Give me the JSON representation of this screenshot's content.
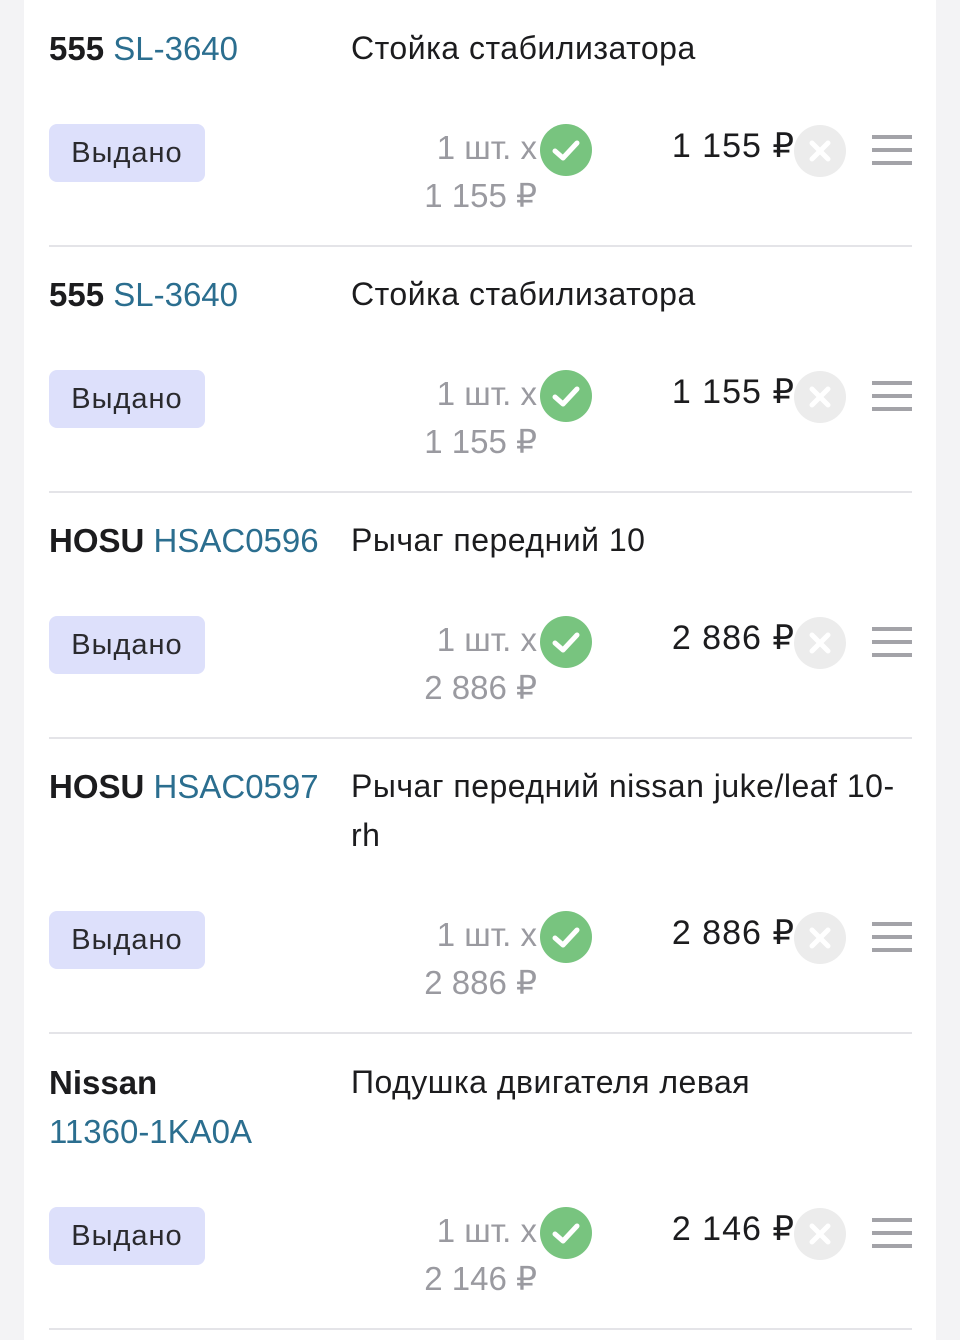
{
  "items": [
    {
      "brand": "555",
      "code": "SL-3640",
      "name": "Стойка стабилизатора",
      "status": "Выдано",
      "qty": "1 шт. x",
      "unit_price": "1 155 ₽",
      "total": "1 155 ₽"
    },
    {
      "brand": "555",
      "code": "SL-3640",
      "name": "Стойка стабилизатора",
      "status": "Выдано",
      "qty": "1 шт. x",
      "unit_price": "1 155 ₽",
      "total": "1 155 ₽"
    },
    {
      "brand": "HOSU",
      "code": "HSAC0596",
      "name": "Рычаг передний 10",
      "status": "Выдано",
      "qty": "1 шт. x",
      "unit_price": "2 886 ₽",
      "total": "2 886 ₽"
    },
    {
      "brand": "HOSU",
      "code": "HSAC0597",
      "name": "Рычаг передний nissan juke/leaf 10- rh",
      "status": "Выдано",
      "qty": "1 шт. x",
      "unit_price": "2 886 ₽",
      "total": "2 886 ₽"
    },
    {
      "brand": "Nissan",
      "code": "11360-1KA0A",
      "name": "Подушка двигателя левая",
      "status": "Выдано",
      "qty": "1 шт. x",
      "unit_price": "2 146 ₽",
      "total": "2 146 ₽"
    }
  ],
  "icons": {
    "confirmed": "check-circle-icon",
    "remove": "close-circle-icon",
    "menu": "hamburger-menu-icon"
  },
  "colors": {
    "code_link": "#2b6e8f",
    "status_bg": "#dde0fb",
    "check_green": "#78c47f"
  }
}
